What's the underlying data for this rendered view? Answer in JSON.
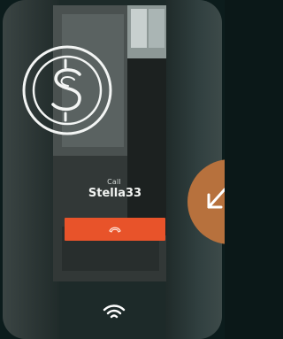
{
  "call": {
    "label": "Call",
    "contact_name": "Stella33"
  },
  "icons": {
    "app_logo": "dollar-s-logo-icon",
    "hangup": "phone-hangup-icon",
    "network": "wifi-icon",
    "incoming": "arrow-down-left-icon"
  },
  "colors": {
    "hangup_button": "#e8532a",
    "call_fab": "#b7713d",
    "text": "#f2f4f2"
  }
}
